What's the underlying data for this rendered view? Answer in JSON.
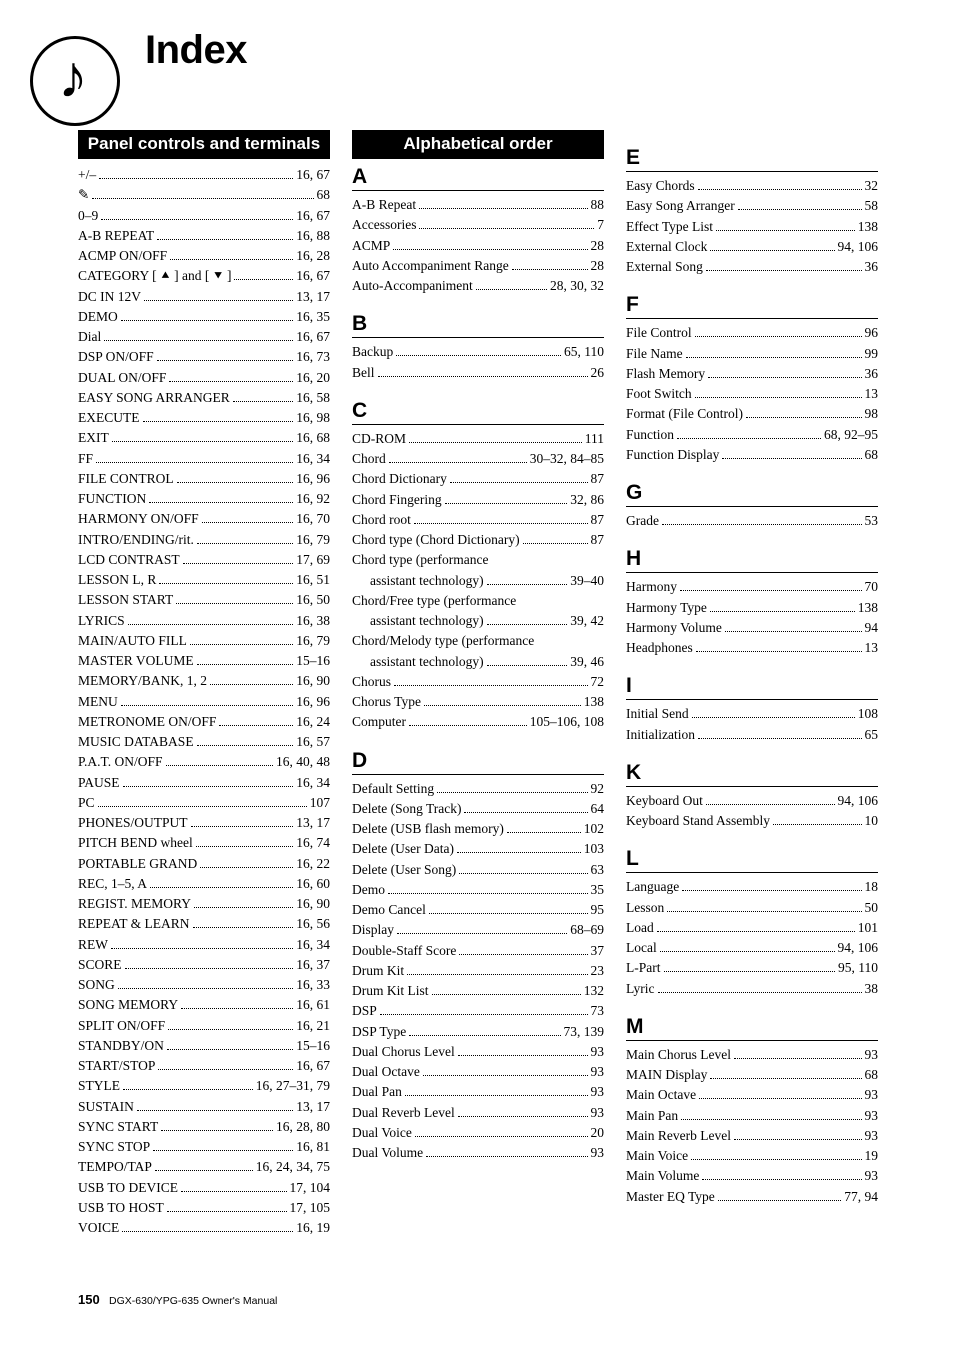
{
  "page_title": "Index",
  "footer": {
    "page_number": "150",
    "manual_title": "DGX-630/YPG-635  Owner's Manual"
  },
  "icon": "music-note",
  "headers": {
    "panel": "Panel controls and terminals",
    "alpha": "Alphabetical order"
  },
  "panel_entries": [
    {
      "label": "+/–",
      "pages": "16, 67"
    },
    {
      "label": "✎",
      "pages": "68"
    },
    {
      "label": "0–9",
      "pages": "16, 67"
    },
    {
      "label": "A-B REPEAT",
      "pages": "16, 88"
    },
    {
      "label": "ACMP ON/OFF",
      "pages": "16, 28"
    },
    {
      "label": "CATEGORY [ ⯅ ] and [ ⯆ ]",
      "pages": "16, 67"
    },
    {
      "label": "DC IN 12V",
      "pages": "13, 17"
    },
    {
      "label": "DEMO",
      "pages": "16, 35"
    },
    {
      "label": "Dial",
      "pages": "16, 67"
    },
    {
      "label": "DSP ON/OFF",
      "pages": "16, 73"
    },
    {
      "label": "DUAL ON/OFF",
      "pages": "16, 20"
    },
    {
      "label": "EASY SONG ARRANGER",
      "pages": "16, 58"
    },
    {
      "label": "EXECUTE",
      "pages": "16, 98"
    },
    {
      "label": "EXIT",
      "pages": "16, 68"
    },
    {
      "label": "FF",
      "pages": "16, 34"
    },
    {
      "label": "FILE CONTROL",
      "pages": "16, 96"
    },
    {
      "label": "FUNCTION",
      "pages": "16, 92"
    },
    {
      "label": "HARMONY ON/OFF",
      "pages": "16, 70"
    },
    {
      "label": "INTRO/ENDING/rit.",
      "pages": "16, 79"
    },
    {
      "label": "LCD CONTRAST",
      "pages": "17, 69"
    },
    {
      "label": "LESSON L, R",
      "pages": "16, 51"
    },
    {
      "label": "LESSON START",
      "pages": "16, 50"
    },
    {
      "label": "LYRICS",
      "pages": "16, 38"
    },
    {
      "label": "MAIN/AUTO FILL",
      "pages": "16, 79"
    },
    {
      "label": "MASTER VOLUME",
      "pages": "15–16"
    },
    {
      "label": "MEMORY/BANK, 1, 2",
      "pages": "16, 90"
    },
    {
      "label": "MENU",
      "pages": "16, 96"
    },
    {
      "label": "METRONOME ON/OFF",
      "pages": "16, 24"
    },
    {
      "label": "MUSIC DATABASE",
      "pages": "16, 57"
    },
    {
      "label": "P.A.T. ON/OFF",
      "pages": "16, 40, 48"
    },
    {
      "label": "PAUSE",
      "pages": "16, 34"
    },
    {
      "label": "PC",
      "pages": "107"
    },
    {
      "label": "PHONES/OUTPUT",
      "pages": "13, 17"
    },
    {
      "label": "PITCH BEND wheel",
      "pages": "16, 74"
    },
    {
      "label": "PORTABLE GRAND",
      "pages": "16, 22"
    },
    {
      "label": "REC, 1–5, A",
      "pages": "16, 60"
    },
    {
      "label": "REGIST. MEMORY",
      "pages": "16, 90"
    },
    {
      "label": "REPEAT & LEARN",
      "pages": "16, 56"
    },
    {
      "label": "REW",
      "pages": "16, 34"
    },
    {
      "label": "SCORE",
      "pages": "16, 37"
    },
    {
      "label": "SONG",
      "pages": "16, 33"
    },
    {
      "label": "SONG MEMORY",
      "pages": "16, 61"
    },
    {
      "label": "SPLIT ON/OFF",
      "pages": "16, 21"
    },
    {
      "label": "STANDBY/ON",
      "pages": "15–16"
    },
    {
      "label": "START/STOP",
      "pages": "16, 67"
    },
    {
      "label": "STYLE",
      "pages": "16, 27–31, 79"
    },
    {
      "label": "SUSTAIN",
      "pages": "13, 17"
    },
    {
      "label": "SYNC START",
      "pages": "16, 28, 80"
    },
    {
      "label": "SYNC STOP",
      "pages": "16, 81"
    },
    {
      "label": "TEMPO/TAP",
      "pages": "16, 24, 34, 75"
    },
    {
      "label": "USB TO DEVICE",
      "pages": "17, 104"
    },
    {
      "label": "USB TO HOST",
      "pages": "17, 105"
    },
    {
      "label": "VOICE",
      "pages": "16, 19"
    }
  ],
  "alpha_sections": [
    {
      "letter": "A",
      "entries": [
        {
          "label": "A-B Repeat",
          "pages": "88"
        },
        {
          "label": "Accessories",
          "pages": "7"
        },
        {
          "label": "ACMP",
          "pages": "28"
        },
        {
          "label": "Auto Accompaniment Range",
          "pages": "28"
        },
        {
          "label": "Auto-Accompaniment",
          "pages": "28, 30, 32"
        }
      ]
    },
    {
      "letter": "B",
      "entries": [
        {
          "label": "Backup",
          "pages": "65, 110"
        },
        {
          "label": "Bell",
          "pages": "26"
        }
      ]
    },
    {
      "letter": "C",
      "entries": [
        {
          "label": "CD-ROM",
          "pages": "111"
        },
        {
          "label": "Chord",
          "pages": "30–32, 84–85"
        },
        {
          "label": "Chord Dictionary",
          "pages": "87"
        },
        {
          "label": "Chord Fingering",
          "pages": "32, 86"
        },
        {
          "label": "Chord root",
          "pages": "87"
        },
        {
          "label": "Chord type (Chord Dictionary)",
          "pages": "87"
        },
        {
          "wrap": true,
          "label1": "Chord type (performance",
          "label2": "assistant technology)",
          "pages": "39–40"
        },
        {
          "wrap": true,
          "label1": "Chord/Free type (performance",
          "label2": "assistant technology)",
          "pages": "39, 42"
        },
        {
          "wrap": true,
          "label1": "Chord/Melody type (performance",
          "label2": "assistant technology)",
          "pages": "39, 46"
        },
        {
          "label": "Chorus",
          "pages": "72"
        },
        {
          "label": "Chorus Type",
          "pages": "138"
        },
        {
          "label": "Computer",
          "pages": "105–106, 108"
        }
      ]
    },
    {
      "letter": "D",
      "entries": [
        {
          "label": "Default Setting",
          "pages": "92"
        },
        {
          "label": "Delete (Song Track)",
          "pages": "64"
        },
        {
          "label": "Delete (USB flash memory)",
          "pages": "102"
        },
        {
          "label": "Delete (User Data)",
          "pages": "103"
        },
        {
          "label": "Delete (User Song)",
          "pages": "63"
        },
        {
          "label": "Demo",
          "pages": "35"
        },
        {
          "label": "Demo Cancel",
          "pages": "95"
        },
        {
          "label": "Display",
          "pages": "68–69"
        },
        {
          "label": "Double-Staff Score",
          "pages": "37"
        },
        {
          "label": "Drum Kit",
          "pages": "23"
        },
        {
          "label": "Drum Kit List",
          "pages": "132"
        },
        {
          "label": "DSP",
          "pages": "73"
        },
        {
          "label": "DSP Type",
          "pages": "73, 139"
        },
        {
          "label": "Dual Chorus Level",
          "pages": "93"
        },
        {
          "label": "Dual Octave",
          "pages": "93"
        },
        {
          "label": "Dual Pan",
          "pages": "93"
        },
        {
          "label": "Dual Reverb Level",
          "pages": "93"
        },
        {
          "label": "Dual Voice",
          "pages": "20"
        },
        {
          "label": "Dual Volume",
          "pages": "93"
        }
      ]
    },
    {
      "letter": "E",
      "entries": [
        {
          "label": "Easy Chords",
          "pages": "32"
        },
        {
          "label": "Easy Song Arranger",
          "pages": "58"
        },
        {
          "label": "Effect Type List",
          "pages": "138"
        },
        {
          "label": "External Clock",
          "pages": "94, 106"
        },
        {
          "label": "External Song",
          "pages": "36"
        }
      ]
    },
    {
      "letter": "F",
      "entries": [
        {
          "label": "File Control",
          "pages": "96"
        },
        {
          "label": "File Name",
          "pages": "99"
        },
        {
          "label": "Flash Memory",
          "pages": "36"
        },
        {
          "label": "Foot Switch",
          "pages": "13"
        },
        {
          "label": "Format (File Control)",
          "pages": "98"
        },
        {
          "label": "Function",
          "pages": "68, 92–95"
        },
        {
          "label": "Function Display",
          "pages": "68"
        }
      ]
    },
    {
      "letter": "G",
      "entries": [
        {
          "label": "Grade",
          "pages": "53"
        }
      ]
    },
    {
      "letter": "H",
      "entries": [
        {
          "label": "Harmony",
          "pages": "70"
        },
        {
          "label": "Harmony Type",
          "pages": "138"
        },
        {
          "label": "Harmony Volume",
          "pages": "94"
        },
        {
          "label": "Headphones",
          "pages": "13"
        }
      ]
    },
    {
      "letter": "I",
      "entries": [
        {
          "label": "Initial Send",
          "pages": "108"
        },
        {
          "label": "Initialization",
          "pages": "65"
        }
      ]
    },
    {
      "letter": "K",
      "entries": [
        {
          "label": "Keyboard Out",
          "pages": "94, 106"
        },
        {
          "label": "Keyboard Stand Assembly",
          "pages": "10"
        }
      ]
    },
    {
      "letter": "L",
      "entries": [
        {
          "label": "Language",
          "pages": "18"
        },
        {
          "label": "Lesson",
          "pages": "50"
        },
        {
          "label": "Load",
          "pages": "101"
        },
        {
          "label": "Local",
          "pages": "94, 106"
        },
        {
          "label": "L-Part",
          "pages": "95, 110"
        },
        {
          "label": "Lyric",
          "pages": "38"
        }
      ]
    },
    {
      "letter": "M",
      "entries": [
        {
          "label": "Main Chorus Level",
          "pages": "93"
        },
        {
          "label": "MAIN Display",
          "pages": "68"
        },
        {
          "label": "Main Octave",
          "pages": "93"
        },
        {
          "label": "Main Pan",
          "pages": "93"
        },
        {
          "label": "Main Reverb Level",
          "pages": "93"
        },
        {
          "label": "Main Voice",
          "pages": "19"
        },
        {
          "label": "Main Volume",
          "pages": "93"
        },
        {
          "label": "Master EQ Type",
          "pages": "77, 94"
        }
      ]
    }
  ]
}
